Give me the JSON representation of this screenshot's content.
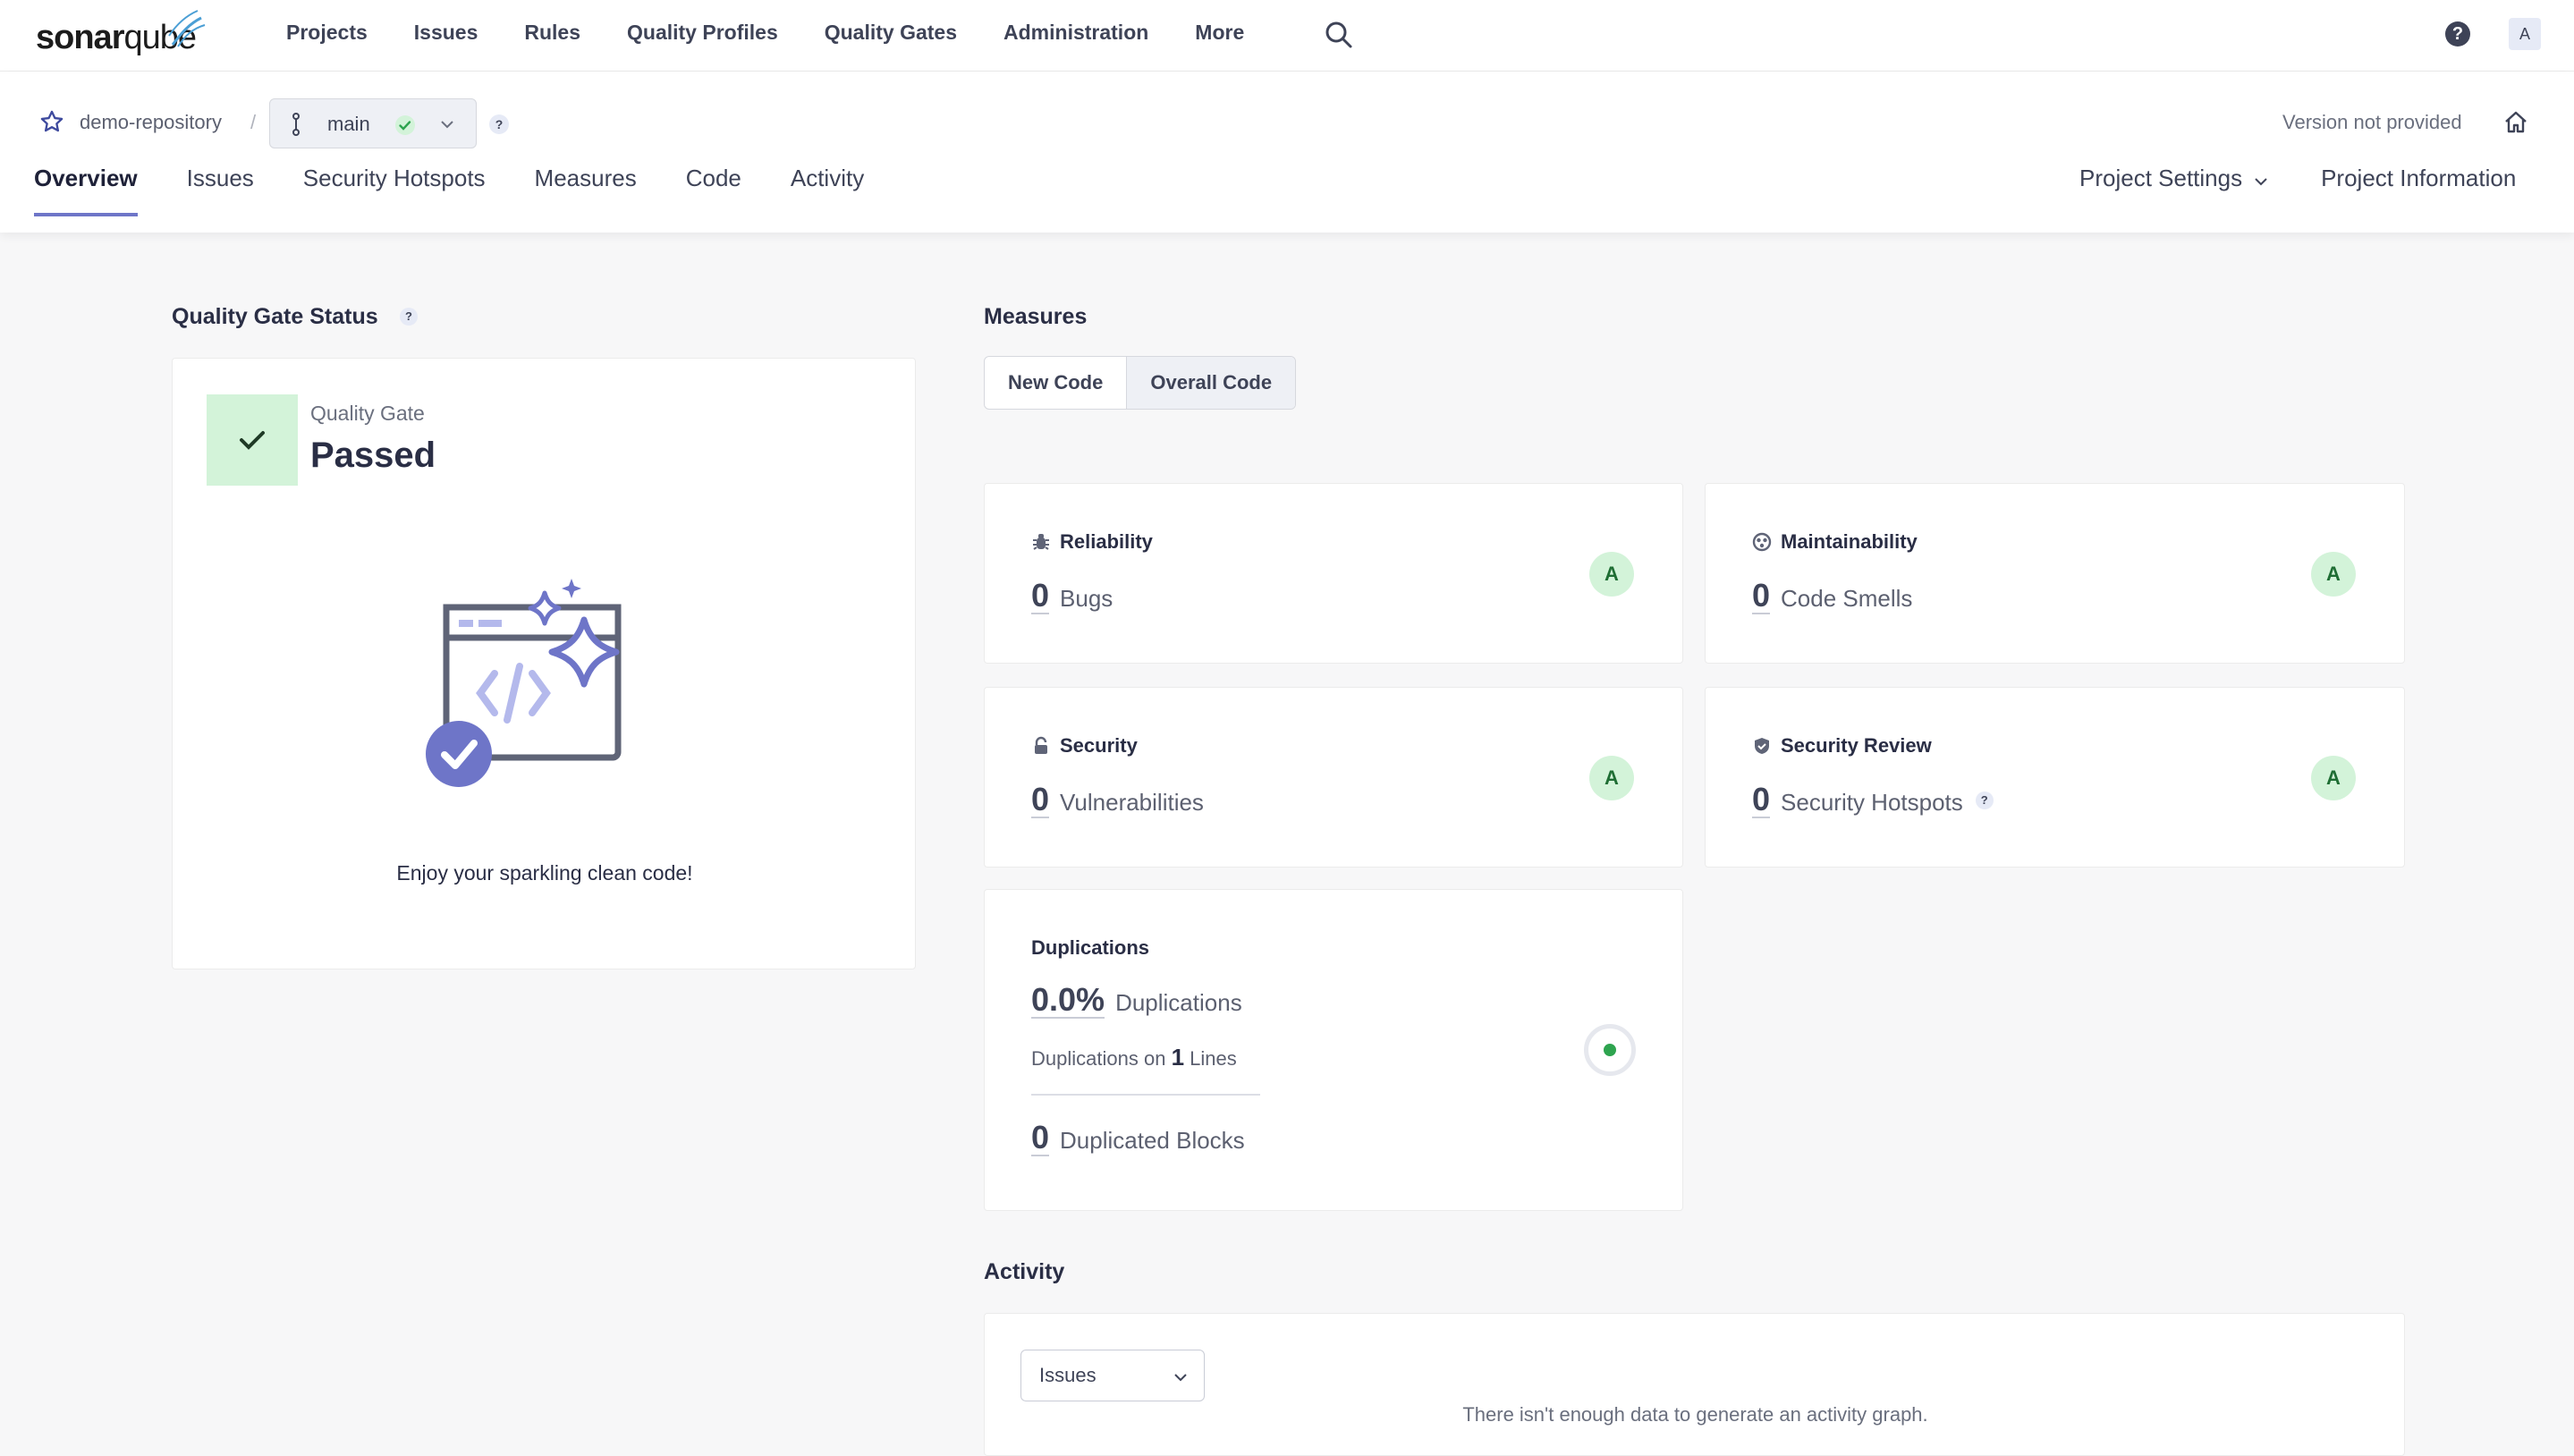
{
  "brand": {
    "logo_main": "sonar",
    "logo_tail": "qube"
  },
  "nav": {
    "items": [
      "Projects",
      "Issues",
      "Rules",
      "Quality Profiles",
      "Quality Gates",
      "Administration",
      "More"
    ],
    "avatar_initial": "A",
    "help_glyph": "?"
  },
  "project": {
    "name": "demo-repository",
    "separator": "/",
    "branch": "main",
    "help_glyph": "?",
    "version": "Version not provided"
  },
  "tabs": [
    "Overview",
    "Issues",
    "Security Hotspots",
    "Measures",
    "Code",
    "Activity"
  ],
  "right_tabs": {
    "settings": "Project Settings",
    "info": "Project Information"
  },
  "quality_gate": {
    "title": "Quality Gate Status",
    "help_glyph": "?",
    "label": "Quality Gate",
    "status": "Passed",
    "message": "Enjoy your sparkling clean code!",
    "status_color": "#d3f3d9"
  },
  "measures": {
    "title": "Measures",
    "toggle": {
      "new": "New Code",
      "overall": "Overall Code"
    },
    "reliability": {
      "title": "Reliability",
      "value": "0",
      "unit": "Bugs",
      "rating": "A"
    },
    "maintainability": {
      "title": "Maintainability",
      "value": "0",
      "unit": "Code Smells",
      "rating": "A"
    },
    "security": {
      "title": "Security",
      "value": "0",
      "unit": "Vulnerabilities",
      "rating": "A"
    },
    "security_review": {
      "title": "Security Review",
      "value": "0",
      "unit": "Security Hotspots",
      "rating": "A",
      "help_glyph": "?"
    },
    "duplications": {
      "title": "Duplications",
      "value": "0.0%",
      "unit": "Duplications",
      "lines_prefix": "Duplications on",
      "lines_value": "1",
      "lines_suffix": "Lines",
      "blocks_value": "0",
      "blocks_unit": "Duplicated Blocks"
    }
  },
  "activity": {
    "title": "Activity",
    "select_value": "Issues",
    "empty_text": "There isn't enough data to generate an activity graph."
  },
  "colors": {
    "accent": "#6e75c8",
    "rating_bg": "#d3f3d9",
    "rating_fg": "#1f6e34"
  }
}
